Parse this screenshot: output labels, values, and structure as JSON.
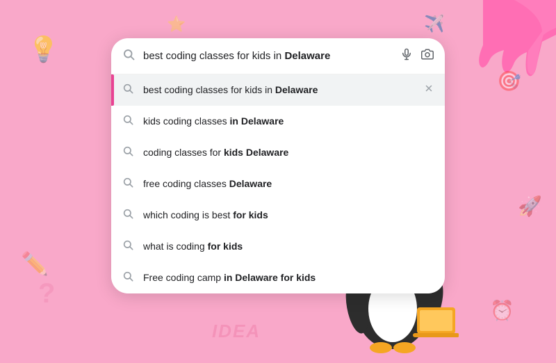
{
  "background": {
    "color": "#f9a8c9"
  },
  "search_bar": {
    "text_before_bold": "best coding classes for kids in ",
    "text_bold": "Delaware",
    "mic_label": "microphone",
    "camera_label": "camera"
  },
  "suggestions": [
    {
      "id": 1,
      "text_normal": "best coding classes for kids in ",
      "text_bold": "Delaware",
      "active": true
    },
    {
      "id": 2,
      "text_normal": "kids coding classes ",
      "text_bold": "in Delaware",
      "active": false
    },
    {
      "id": 3,
      "text_normal": "coding classes for ",
      "text_bold": "kids Delaware",
      "active": false
    },
    {
      "id": 4,
      "text_normal": "free coding classes ",
      "text_bold": "Delaware",
      "active": false
    },
    {
      "id": 5,
      "text_normal": "which coding is best ",
      "text_bold": "for kids",
      "active": false
    },
    {
      "id": 6,
      "text_normal": "what is coding ",
      "text_bold": "for kids",
      "active": false
    },
    {
      "id": 7,
      "text_normal": "Free coding camp ",
      "text_bold": "in Delaware for kids",
      "active": false
    }
  ],
  "idea_label": "IDEA"
}
